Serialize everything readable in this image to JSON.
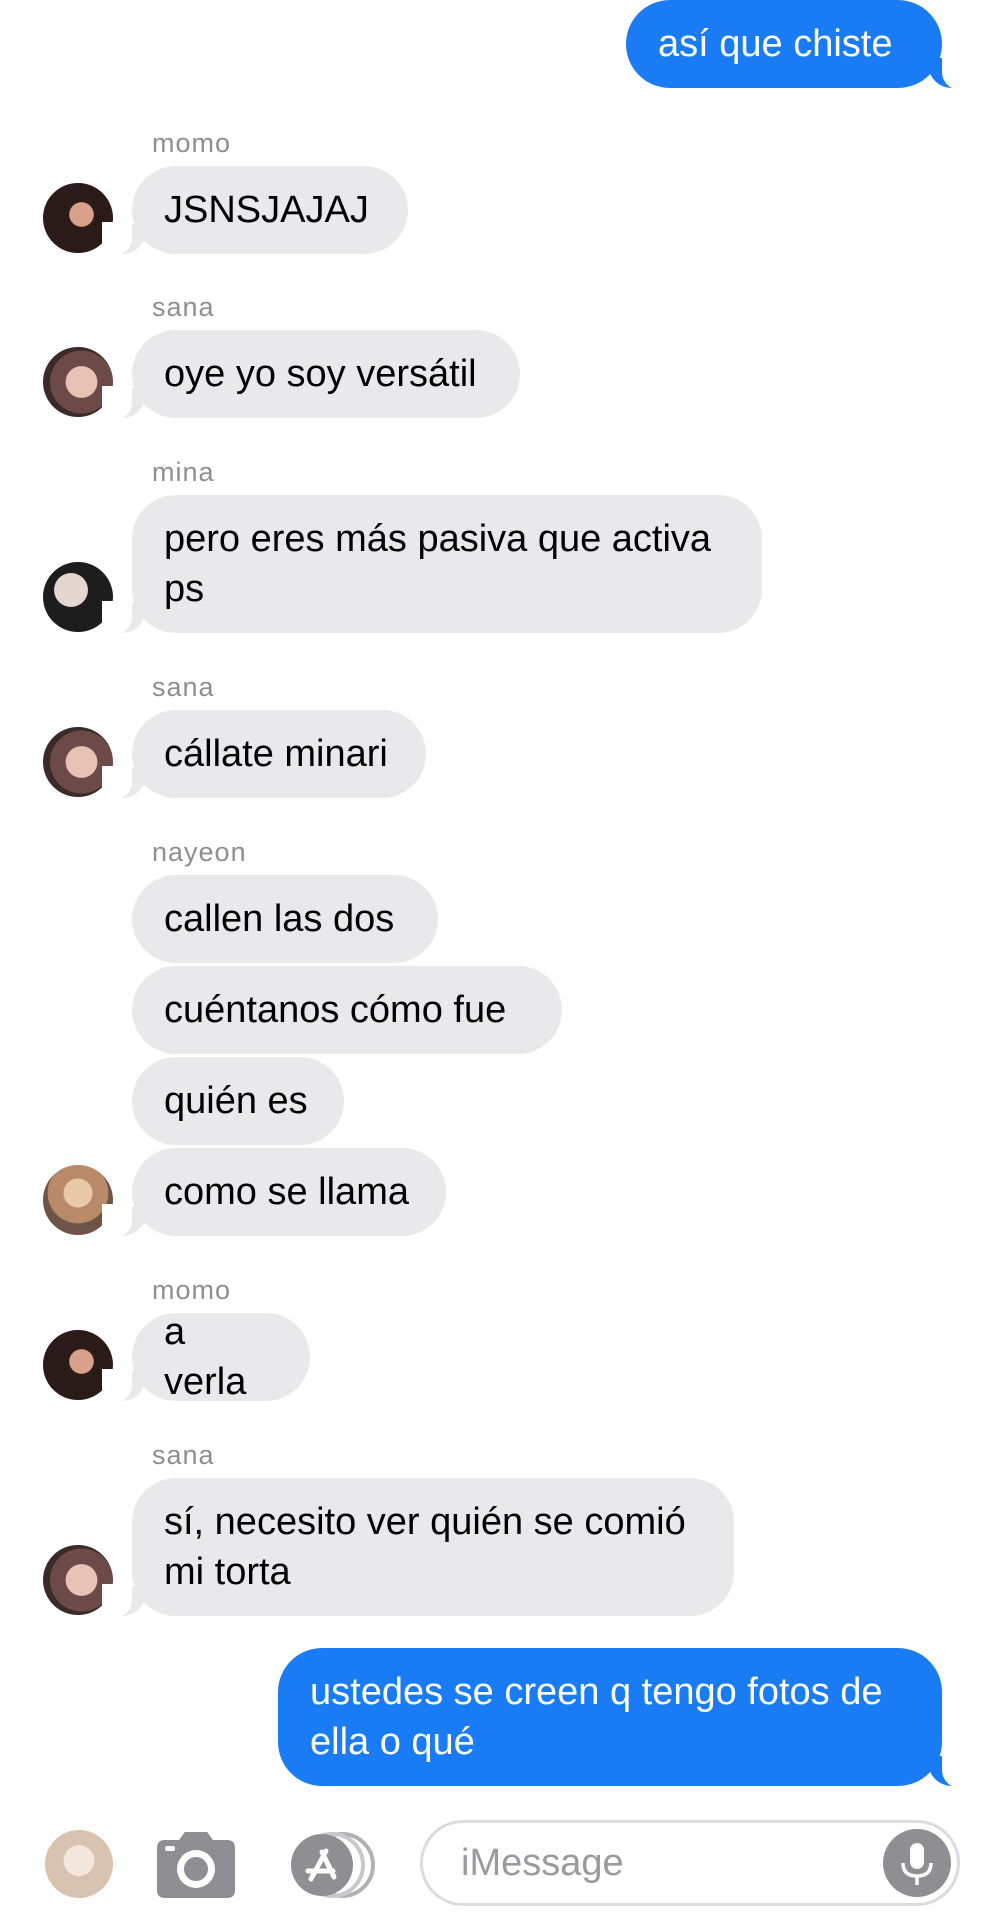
{
  "messages": [
    {
      "sender": "me",
      "text": "así que chiste"
    },
    {
      "sender": "momo",
      "text": "JSNSJAJAJ"
    },
    {
      "sender": "sana",
      "text": "oye yo soy versátil"
    },
    {
      "sender": "mina",
      "text": "pero eres más pasiva que activa\nps"
    },
    {
      "sender": "sana",
      "text": "cállate minari"
    },
    {
      "sender": "nayeon",
      "text": "callen las dos"
    },
    {
      "sender": "nayeon",
      "text": "cuéntanos cómo fue"
    },
    {
      "sender": "nayeon",
      "text": "quién es"
    },
    {
      "sender": "nayeon",
      "text": "como se llama"
    },
    {
      "sender": "momo",
      "text": "a verla"
    },
    {
      "sender": "sana",
      "text": "sí, necesito ver quién se comió\nmi torta"
    },
    {
      "sender": "me",
      "text": "ustedes se creen q tengo fotos de\nella o qué"
    }
  ],
  "input": {
    "placeholder": "iMessage"
  },
  "icons": [
    "camera-icon",
    "app-store-icon",
    "microphone-icon"
  ],
  "colors": {
    "outgoing_bubble": "#1a7cf5",
    "incoming_bubble": "#e9e9eb",
    "sender_name": "#8e8e93"
  }
}
